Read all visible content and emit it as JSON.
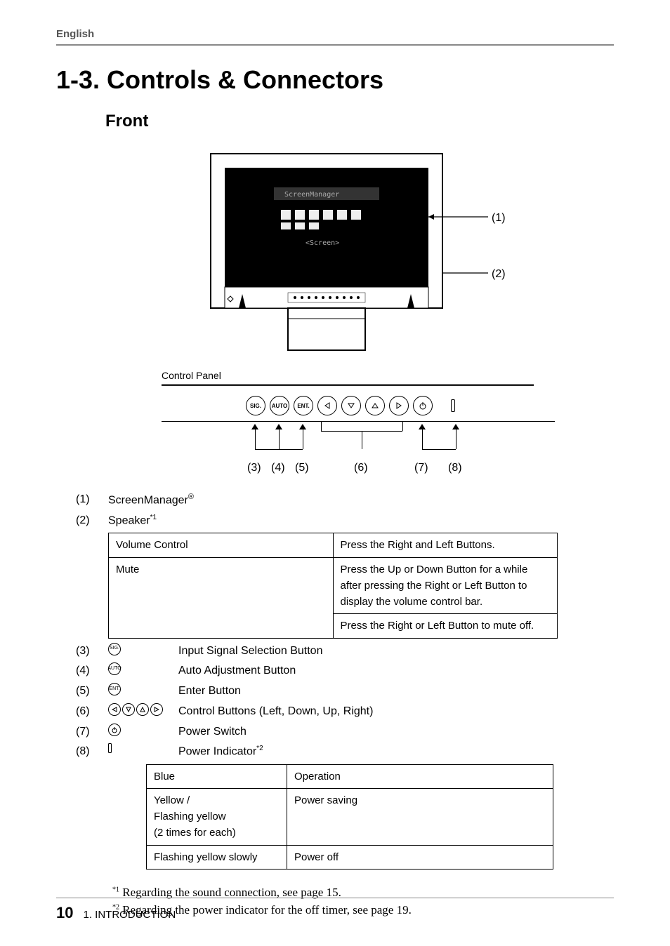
{
  "header": {
    "lang": "English"
  },
  "headings": {
    "main": "1-3. Controls & Connectors",
    "front": "Front",
    "panel_label": "Control Panel"
  },
  "monitor_pointers": {
    "p1": "(1)",
    "p2": "(2)"
  },
  "panel_pointer_labels": {
    "p3": "(3)",
    "p4": "(4)",
    "p5": "(5)",
    "p6": "(6)",
    "p7": "(7)",
    "p8": "(8)"
  },
  "panel_button_labels": {
    "sig": "SIG.",
    "auto": "AUTO",
    "ent": "ENT."
  },
  "spec": {
    "r1": {
      "num": "(1)",
      "desc": "ScreenManager",
      "reg": "®"
    },
    "r2": {
      "num": "(2)",
      "desc": "Speaker",
      "sup": "*1"
    },
    "r3": {
      "num": "(3)",
      "desc": "Input Signal Selection Button",
      "icon": "SIG."
    },
    "r4": {
      "num": "(4)",
      "desc": "Auto Adjustment Button",
      "icon": "AUTO"
    },
    "r5": {
      "num": "(5)",
      "desc": "Enter Button",
      "icon": "ENT."
    },
    "r6": {
      "num": "(6)",
      "desc": "Control Buttons (Left, Down, Up, Right)"
    },
    "r7": {
      "num": "(7)",
      "desc": "Power Switch"
    },
    "r8": {
      "num": "(8)",
      "desc": "Power Indicator",
      "sup": "*2"
    }
  },
  "inner_table": {
    "r1c1": "Volume Control",
    "r1c2": "Press the Right and Left Buttons.",
    "r2c1": "Mute",
    "r2c2a": "Press the Up or Down Button for a while after pressing the Right or Left Button to display the volume control bar.",
    "r2c2b": "Press the Right or Left Button to mute off."
  },
  "status_table": {
    "r1c1": "Blue",
    "r1c2": "Operation",
    "r2c1": "Yellow /\nFlashing yellow\n(2 times for each)",
    "r2c2": "Power saving",
    "r3c1": "Flashing yellow slowly",
    "r3c2": "Power off"
  },
  "footnotes": {
    "f1_sup": "*1",
    "f1": " Regarding the sound connection, see page 15.",
    "f2_sup": "*2",
    "f2": " Regarding the power indicator for the off timer, see page 19."
  },
  "footer": {
    "page": "10",
    "text": "1. INTRODUCTION"
  }
}
